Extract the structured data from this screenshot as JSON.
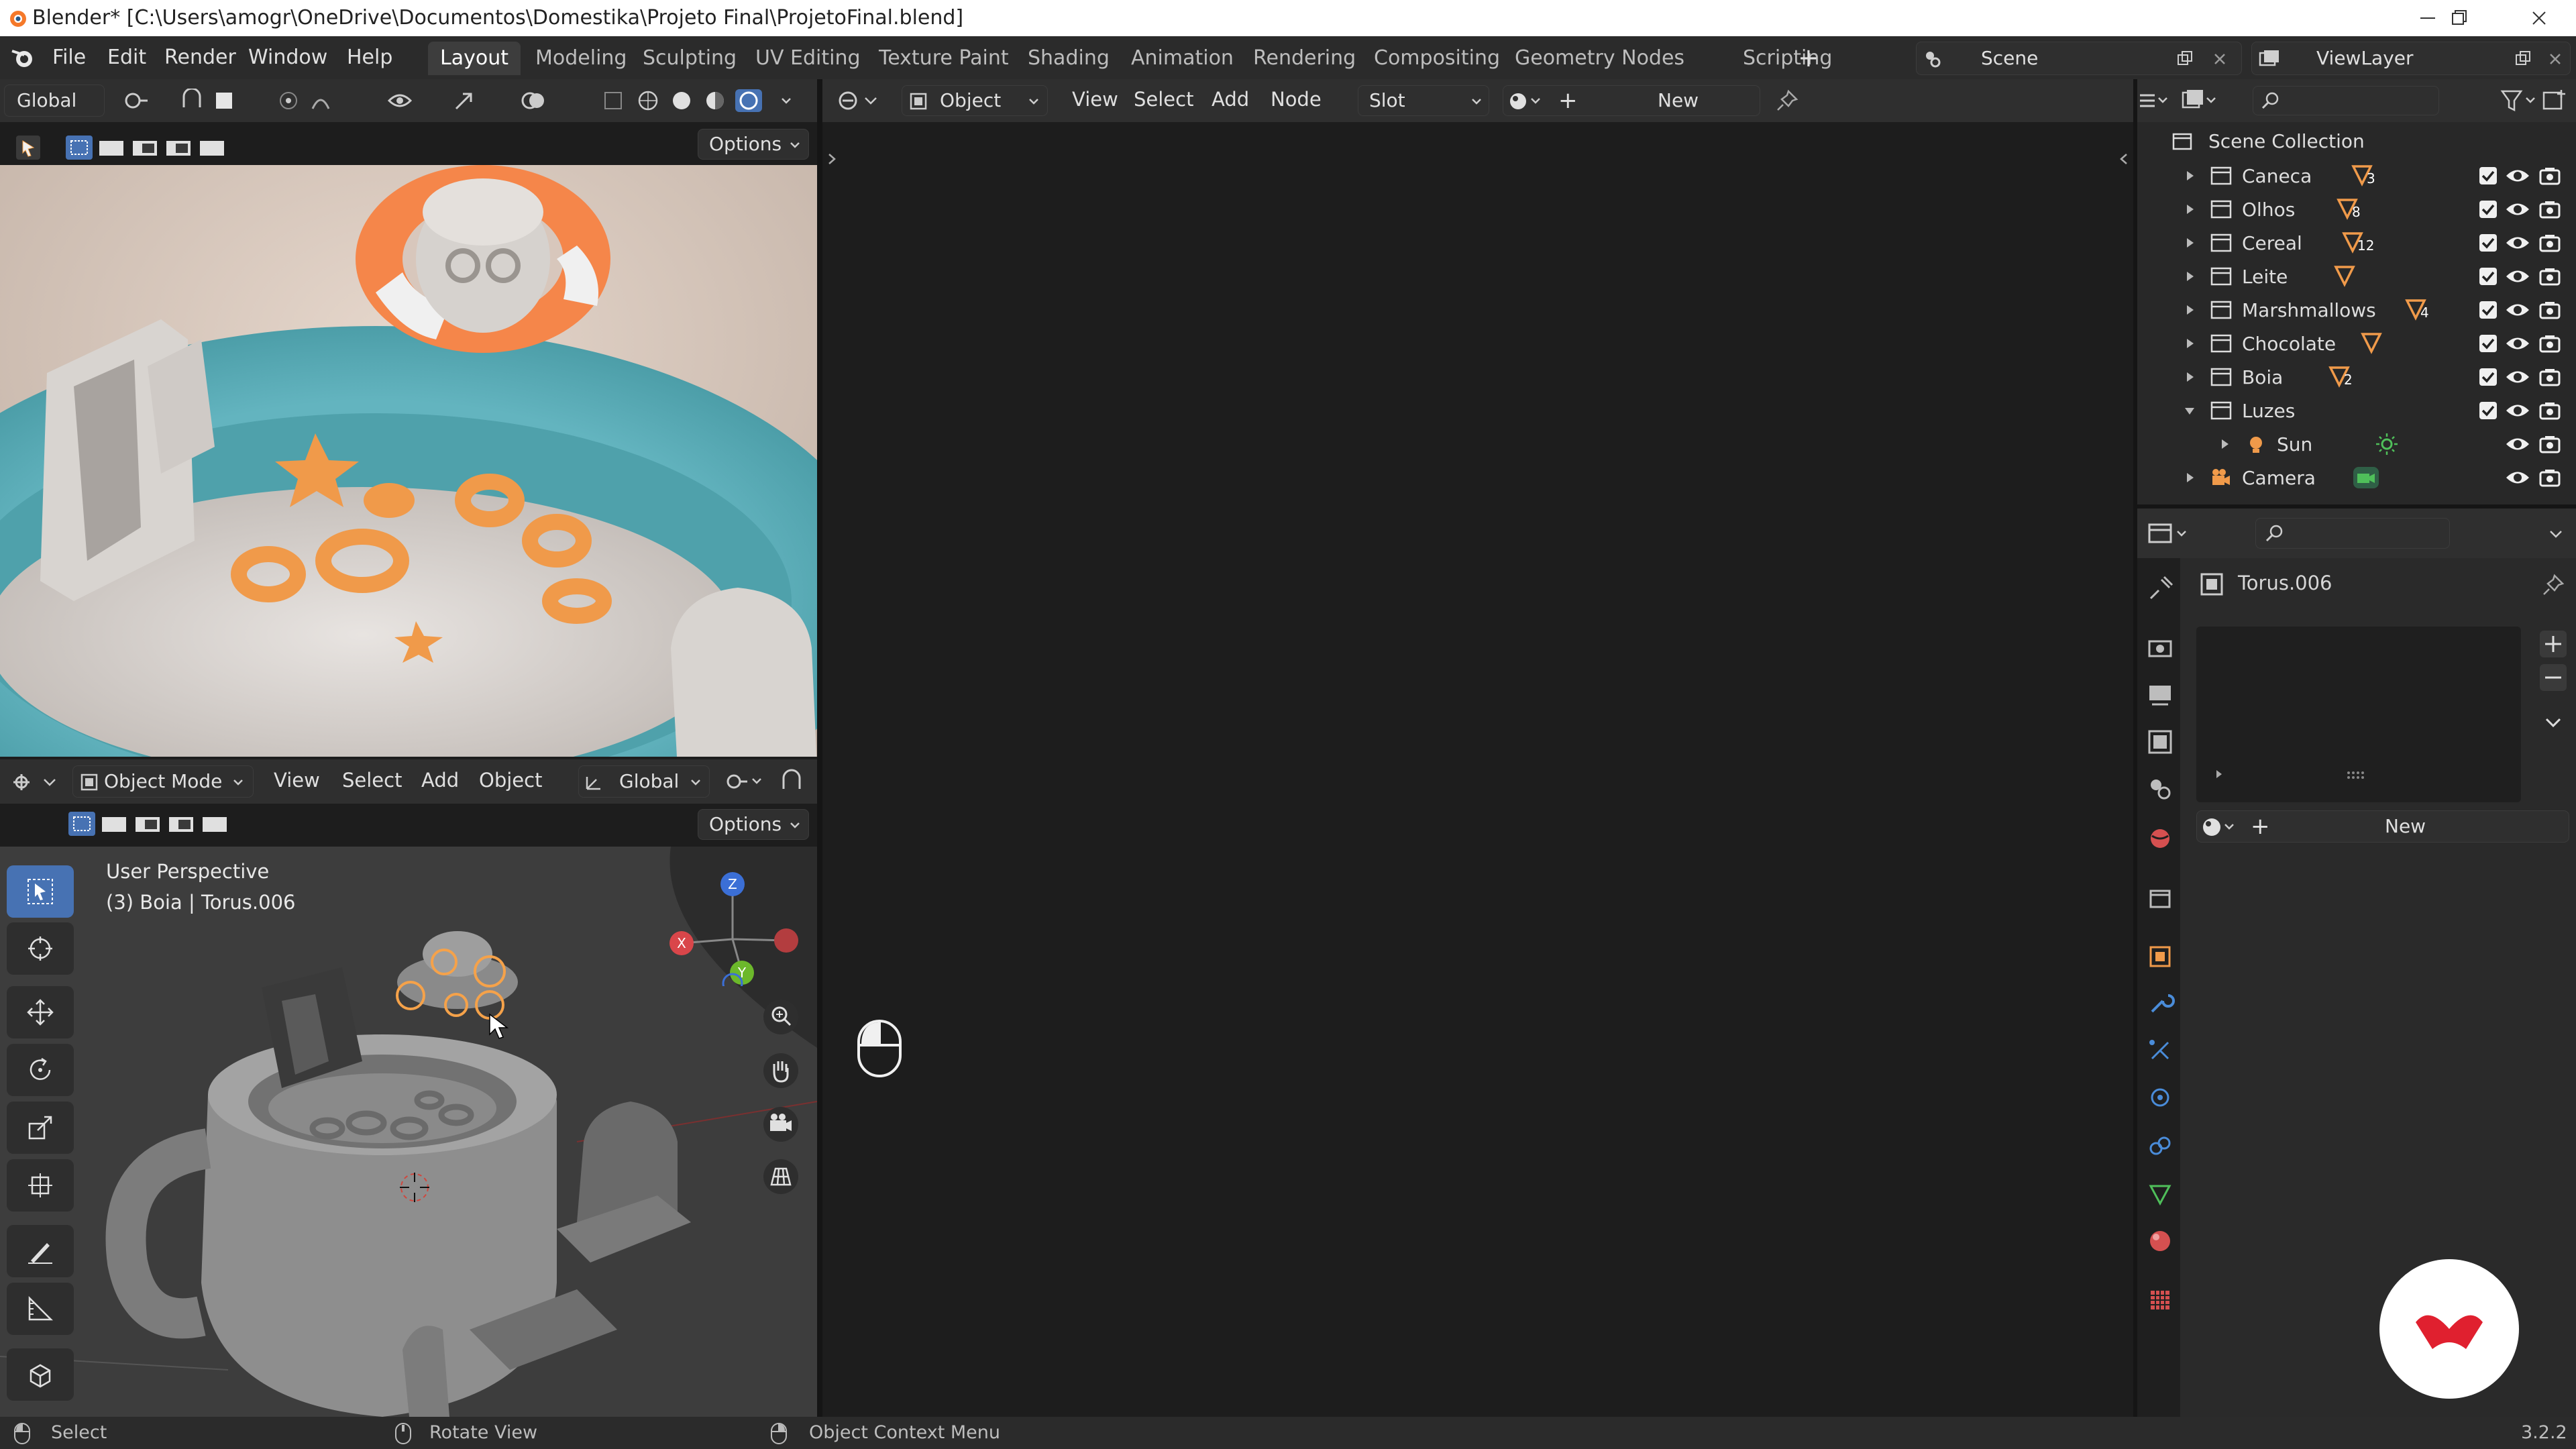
{
  "window": {
    "title": "Blender* [C:\\Users\\amogr\\OneDrive\\Documentos\\Domestika\\Projeto Final\\ProjetoFinal.blend]"
  },
  "menu": {
    "items": [
      "File",
      "Edit",
      "Render",
      "Window",
      "Help"
    ]
  },
  "workspaces": {
    "tabs": [
      "Layout",
      "Modeling",
      "Sculpting",
      "UV Editing",
      "Texture Paint",
      "Shading",
      "Animation",
      "Rendering",
      "Compositing",
      "Geometry Nodes",
      "Scripting"
    ],
    "active": "Layout",
    "add_symbol": "+"
  },
  "scene": {
    "label": "Scene"
  },
  "view_layer": {
    "label": "ViewLayer"
  },
  "top_viewport": {
    "transform_orientation": "Global",
    "options_label": "Options"
  },
  "bottom_viewport": {
    "mode": "Object Mode",
    "menus": [
      "View",
      "Select",
      "Add",
      "Object"
    ],
    "transform_orientation": "Global",
    "options_label": "Options",
    "perspective_label": "User Perspective",
    "object_label": "(3) Boia | Torus.006",
    "axis": {
      "x": "X",
      "y": "Y",
      "z": "Z"
    }
  },
  "shader_editor": {
    "object_type": "Object",
    "menus": [
      "View",
      "Select",
      "Add",
      "Node"
    ],
    "slot": "Slot",
    "new_label": "New",
    "plus": "+"
  },
  "outliner": {
    "root": "Scene Collection",
    "collections": [
      {
        "name": "Caneca",
        "count": "3",
        "icon": "mesh-triangle-icon"
      },
      {
        "name": "Olhos",
        "count": "8",
        "icon": "mesh-triangle-icon"
      },
      {
        "name": "Cereal",
        "count": "12",
        "icon": "mesh-triangle-icon"
      },
      {
        "name": "Leite",
        "count": "",
        "icon": "mesh-triangle-icon"
      },
      {
        "name": "Marshmallows",
        "count": "4",
        "icon": "mesh-triangle-icon"
      },
      {
        "name": "Chocolate",
        "count": "",
        "icon": "mesh-triangle-icon"
      },
      {
        "name": "Boia",
        "count": "2",
        "icon": "mesh-triangle-icon"
      },
      {
        "name": "Luzes",
        "count": "",
        "icon": ""
      },
      {
        "name": "Sun",
        "count": "",
        "icon": "sun-icon"
      },
      {
        "name": "Camera",
        "count": "",
        "icon": "camera-icon"
      }
    ]
  },
  "properties": {
    "object_name": "Torus.006",
    "new_label": "New",
    "plus": "+"
  },
  "status_bar": {
    "select": "Select",
    "rotate": "Rotate View",
    "context": "Object Context Menu",
    "version": "3.2.2"
  },
  "colors": {
    "accent": "#4772b3",
    "header_bg": "#2f2f2f",
    "editor_bg": "#1d1d1d",
    "selection_orange": "#f5a24a",
    "brand_red": "#e0202f"
  }
}
